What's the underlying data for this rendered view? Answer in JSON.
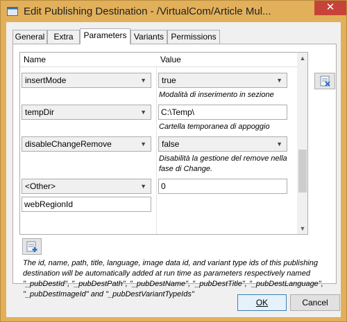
{
  "window": {
    "title": "Edit Publishing Destination - /VirtualCom/Article Mul...",
    "close_glyph": "✕"
  },
  "tabs": [
    {
      "label": "General"
    },
    {
      "label": "Extra"
    },
    {
      "label": "Parameters",
      "active": true
    },
    {
      "label": "Variants"
    },
    {
      "label": "Permissions"
    }
  ],
  "grid": {
    "headers": {
      "name": "Name",
      "value": "Value"
    },
    "rows": [
      {
        "name": "insertMode",
        "value": "true",
        "value_kind": "combo",
        "description": "Modalità di inserimento in sezione"
      },
      {
        "name": "tempDir",
        "value": "C:\\Temp\\",
        "value_kind": "text",
        "description": "Cartella temporanea di appoggio"
      },
      {
        "name": "disableChangeRemove",
        "value": "false",
        "value_kind": "combo",
        "description": "Disabilità la gestione del remove nella fase di Change."
      },
      {
        "name": "<Other>",
        "value": "0",
        "value_kind": "text",
        "description": ""
      }
    ],
    "other_name_value": "webRegionId"
  },
  "info_text": "The id, name, path, title, language, image data id, and variant type ids of this publishing destination will be automatically added at run time as parameters respectively named \"_pubDestId\", \"_pubDestPath\", \"_pubDestName\", \"_pubDestTitle\", \"_pubDestLanguage\", \"_pubDestImageId\" and \"_pubDestVariantTypeIds\"",
  "buttons": {
    "ok": "OK",
    "cancel": "Cancel"
  },
  "icons": {
    "app": "window-icon",
    "side": "remove-parameter-icon",
    "add": "add-parameter-icon"
  },
  "colors": {
    "title_bar": "#e2b05a",
    "close_button": "#c7433a",
    "ok_border": "#3c7fb1"
  }
}
